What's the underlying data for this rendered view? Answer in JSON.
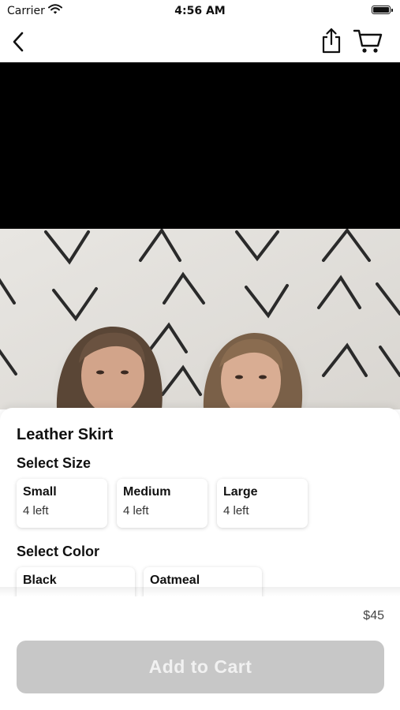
{
  "status_bar": {
    "carrier": "Carrier",
    "time": "4:56 AM",
    "wifi_icon": "wifi-icon",
    "battery_icon": "battery-icon"
  },
  "nav": {
    "back_icon": "chevron-left-icon",
    "share_icon": "share-icon",
    "cart_icon": "cart-icon"
  },
  "product": {
    "title": "Leather Skirt",
    "price": "$45"
  },
  "size_section": {
    "label": "Select Size",
    "options": [
      {
        "name": "Small",
        "stock": "4 left"
      },
      {
        "name": "Medium",
        "stock": "4 left"
      },
      {
        "name": "Large",
        "stock": "4 left"
      }
    ]
  },
  "color_section": {
    "label": "Select Color",
    "options": [
      {
        "name": "Black"
      },
      {
        "name": "Oatmeal"
      }
    ]
  },
  "cta": {
    "add_to_cart_label": "Add to Cart",
    "enabled": false
  },
  "colors": {
    "button_disabled_bg": "#c7c7c7",
    "button_disabled_text": "#f1f1f1",
    "media_band": "#000000"
  }
}
